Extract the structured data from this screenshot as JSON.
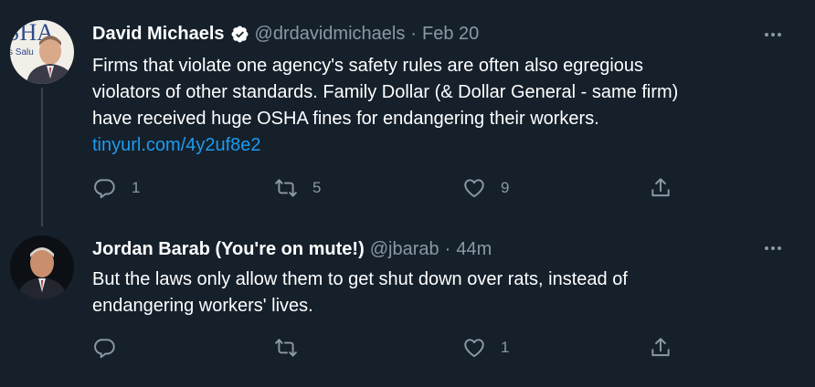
{
  "tweets": [
    {
      "display_name": "David Michaels",
      "verified": true,
      "handle": "@drdavidmichaels",
      "separator": "·",
      "time": "Feb 20",
      "text_lines": [
        "Firms that violate one agency's safety rules are often also egregious",
        "violators of other standards. Family Dollar (& Dollar General - same firm)",
        "have received huge OSHA fines for endangering their workers."
      ],
      "link": "tinyurl.com/4y2uf8e2",
      "replies": "1",
      "retweets": "5",
      "likes": "9",
      "avatar_text": "SHA",
      "avatar_text2": "s Salu"
    },
    {
      "display_name": "Jordan Barab (You're on mute!)",
      "verified": false,
      "handle": "@jbarab",
      "separator": "·",
      "time": "44m",
      "text_lines": [
        "But the laws only allow them to get shut down over rats, instead of",
        "endangering workers' lives."
      ],
      "replies": "",
      "retweets": "",
      "likes": "1"
    }
  ],
  "icons": {
    "more": "more-horizontal-icon",
    "reply": "reply-icon",
    "retweet": "retweet-icon",
    "like": "heart-icon",
    "share": "share-icon",
    "verified": "verified-badge-icon"
  },
  "colors": {
    "background": "#15202b",
    "text": "#ffffff",
    "secondary": "#8b98a5",
    "link": "#1d9bf0",
    "thread_line": "#38444d"
  }
}
